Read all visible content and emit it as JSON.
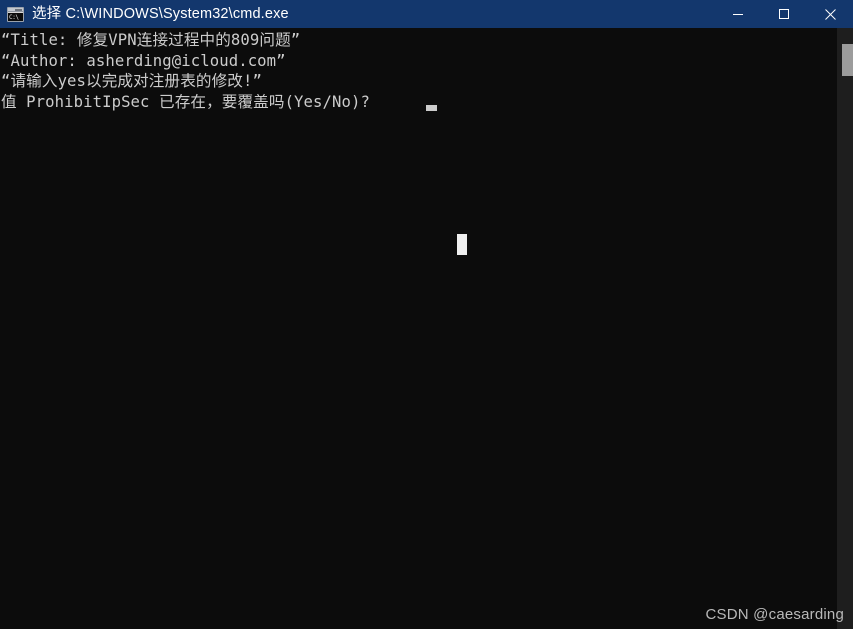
{
  "window": {
    "title": "选择 C:\\WINDOWS\\System32\\cmd.exe",
    "icon_name": "cmd-console-icon",
    "icon_text": "C:\\",
    "titlebar_color": "#13376d",
    "background_color": "#0c0c0c",
    "text_color": "#cccccc"
  },
  "controls": {
    "minimize_label": "最小化",
    "maximize_label": "最大化",
    "close_label": "关闭"
  },
  "console": {
    "lines": [
      "“Title: 修复VPN连接过程中的809问题”",
      "“Author: asherding@icloud.com”",
      "“请输入yes以完成对注册表的修改!”",
      "值 ProhibitIpSec 已存在，要覆盖吗(Yes/No)?"
    ],
    "caret": "_",
    "block_cursor": ""
  },
  "scrollbar": {
    "track_color": "#1e1e1e",
    "thumb_color": "#9c9c9c"
  },
  "watermark": {
    "text": "CSDN @caesarding"
  }
}
